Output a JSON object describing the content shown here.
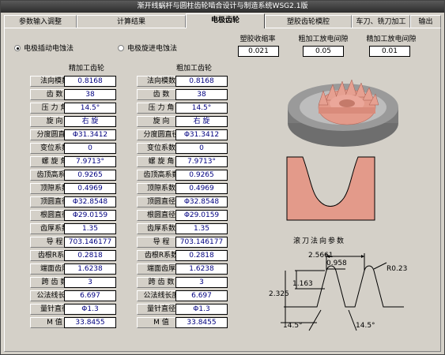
{
  "window": {
    "title": "渐开线蜗杆与圆柱齿轮啮合设计与制造系统WSG2.1版"
  },
  "tabs": [
    {
      "label": "参数输入调整"
    },
    {
      "label": "计算结果"
    },
    {
      "label": "电极齿轮"
    },
    {
      "label": "塑胶齿轮模腔"
    },
    {
      "label": "车刀、铣刀加工"
    },
    {
      "label": "输出"
    }
  ],
  "method": {
    "option1": "电极插动电蚀法",
    "option2": "电极旋进电蚀法",
    "selected": "电极插动电蚀法"
  },
  "params": {
    "shrink_label": "塑胶收缩率",
    "shrink_value": "0.021",
    "rough_gap_label": "粗加工放电间隙",
    "rough_gap_value": "0.05",
    "fine_gap_label": "精加工放电间隙",
    "fine_gap_value": "0.01"
  },
  "fine": {
    "header": "精加工齿轮",
    "rows": [
      {
        "label": "法向模数",
        "value": "0.8168"
      },
      {
        "label": "齿      数",
        "value": "38"
      },
      {
        "label": "压 力 角",
        "value": "14.5°"
      },
      {
        "label": "旋      向",
        "value": "右 旋"
      },
      {
        "label": "分度圆直径",
        "value": "Φ31.3412"
      },
      {
        "label": "变位系数",
        "value": "0"
      },
      {
        "label": "螺 旋 角",
        "value": "7.9713°"
      },
      {
        "label": "齿顶高系数",
        "value": "0.9265"
      },
      {
        "label": "顶隙系数",
        "value": "0.4969"
      },
      {
        "label": "顶圆直径",
        "value": "Φ32.8548"
      },
      {
        "label": "根圆直径",
        "value": "Φ29.0159"
      },
      {
        "label": "齿厚系数",
        "value": "1.35"
      },
      {
        "label": "导      程",
        "value": "703.146177"
      },
      {
        "label": "齿根R系数",
        "value": "0.2818"
      },
      {
        "label": "端面齿厚",
        "value": "1.6238"
      },
      {
        "label": "跨 齿 数",
        "value": "3"
      },
      {
        "label": "公法线长度",
        "value": "6.697"
      },
      {
        "label": "量针直径",
        "value": "Φ1.3"
      },
      {
        "label": "M      值",
        "value": "33.8455"
      }
    ]
  },
  "rough": {
    "header": "粗加工齿轮",
    "rows": [
      {
        "label": "法向模数",
        "value": "0.8168"
      },
      {
        "label": "齿      数",
        "value": "38"
      },
      {
        "label": "压 力 角",
        "value": "14.5°"
      },
      {
        "label": "旋      向",
        "value": "右 旋"
      },
      {
        "label": "分度圆直径",
        "value": "Φ31.3412"
      },
      {
        "label": "变位系数",
        "value": "0"
      },
      {
        "label": "螺 旋 角",
        "value": "7.9713°"
      },
      {
        "label": "齿顶高系数",
        "value": "0.9265"
      },
      {
        "label": "顶隙系数",
        "value": "0.4969"
      },
      {
        "label": "顶圆直径",
        "value": "Φ32.8548"
      },
      {
        "label": "根圆直径",
        "value": "Φ29.0159"
      },
      {
        "label": "齿厚系数",
        "value": "1.35"
      },
      {
        "label": "导      程",
        "value": "703.146177"
      },
      {
        "label": "齿根R系数",
        "value": "0.2818"
      },
      {
        "label": "端面齿厚",
        "value": "1.6238"
      },
      {
        "label": "跨 齿 数",
        "value": "3"
      },
      {
        "label": "公法线长度",
        "value": "6.697"
      },
      {
        "label": "量针直径",
        "value": "Φ1.3"
      },
      {
        "label": "M      值",
        "value": "33.8455"
      }
    ]
  },
  "cutter": {
    "title": "滚刀法向参数",
    "pitch": "2.5661",
    "top_width": "0.958",
    "radius": "R0.23",
    "addendum": "1.163",
    "depth": "2.325",
    "angle_left": "14.5°",
    "angle_right": "14.5°"
  },
  "colors": {
    "gear_fill": "#e39a8a",
    "gear_body": "#8a8a8a",
    "panel": "#d4d0c8"
  }
}
